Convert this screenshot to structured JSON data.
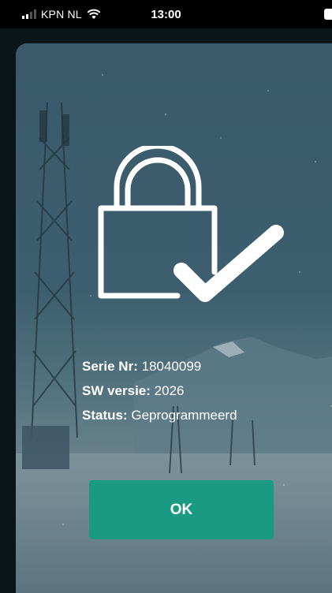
{
  "status_bar": {
    "carrier": "KPN NL",
    "time": "13:00"
  },
  "info": {
    "serial_label": "Serie Nr:",
    "serial_value": "18040099",
    "sw_label": "SW versie:",
    "sw_value": "2026",
    "status_label": "Status:",
    "status_value": "Geprogrammeerd"
  },
  "ok_button": {
    "label": "OK"
  },
  "colors": {
    "accent": "#1b9a83",
    "background": "#3d5e6e"
  },
  "icons": [
    "signal-icon",
    "wifi-icon",
    "battery-icon",
    "lock-check-icon"
  ]
}
